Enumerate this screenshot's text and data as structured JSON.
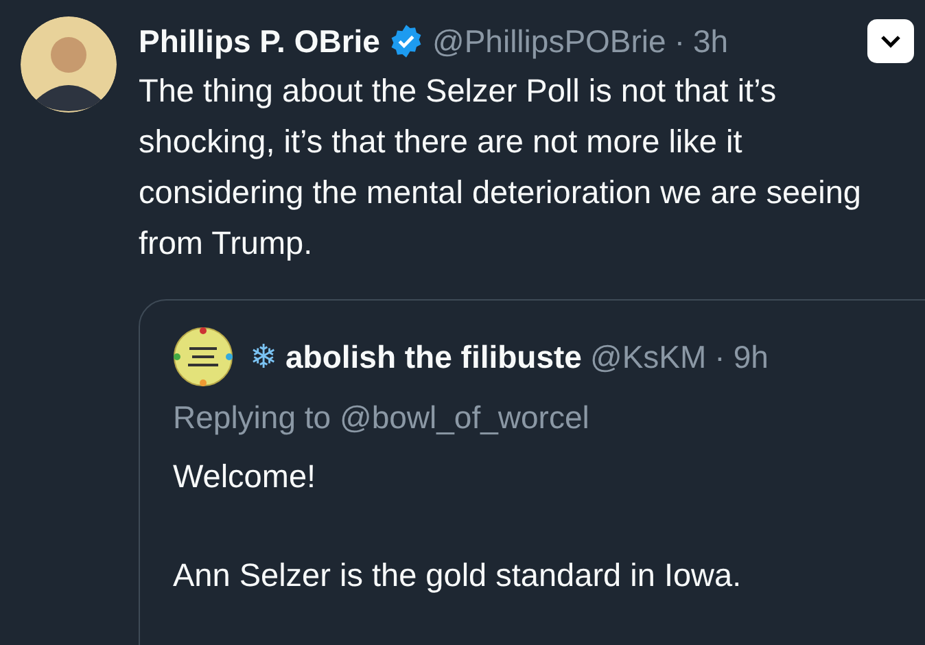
{
  "tweet": {
    "name": "Phillips P. OBrie",
    "verified": true,
    "handle": "@PhillipsPOBrie",
    "separator": "·",
    "time": "3h",
    "text": "The thing about the Selzer Poll is not that it’s shocking, it’s that there are not more like it considering the mental deterioration we are seeing from Trump.",
    "quote": {
      "emoji": "❄",
      "name": "abolish the filibuste",
      "handle": "@KsKM",
      "separator": "·",
      "time": "9h",
      "replying_label": "Replying to",
      "replying_handle": "@bowl_of_worcel",
      "paragraphs": [
        "Welcome!",
        "Ann Selzer is the gold standard in Iowa."
      ]
    }
  }
}
